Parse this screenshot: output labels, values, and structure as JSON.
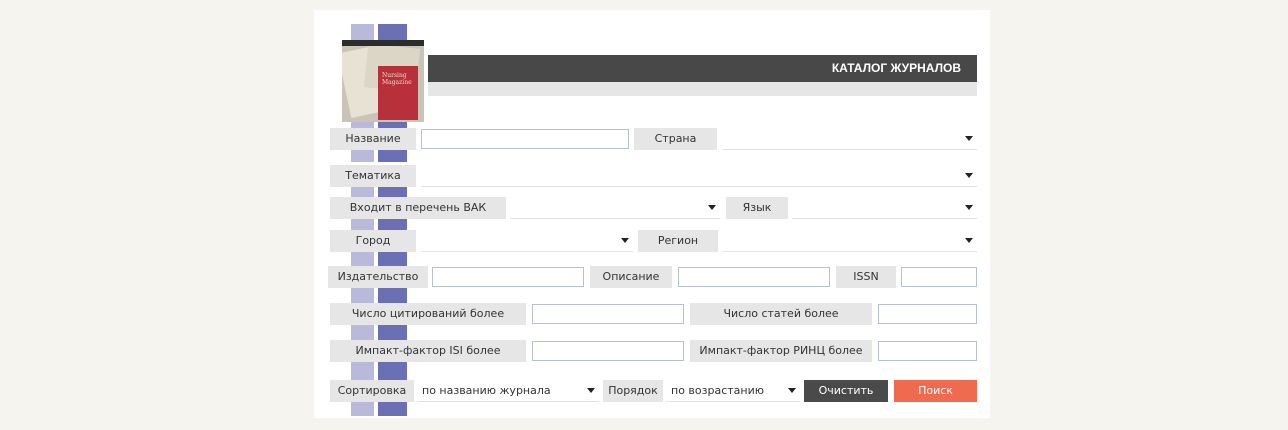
{
  "header": {
    "title": "КАТАЛОГ ЖУРНАЛОВ"
  },
  "cover": {
    "text": "Nursing Magazine"
  },
  "fields": {
    "name": {
      "label": "Название",
      "value": ""
    },
    "country": {
      "label": "Страна",
      "value": ""
    },
    "subject": {
      "label": "Тематика",
      "value": ""
    },
    "vak": {
      "label": "Входит в перечень ВАК",
      "value": ""
    },
    "language": {
      "label": "Язык",
      "value": ""
    },
    "city": {
      "label": "Город",
      "value": ""
    },
    "region": {
      "label": "Регион",
      "value": ""
    },
    "publisher": {
      "label": "Издательство",
      "value": ""
    },
    "description": {
      "label": "Описание",
      "value": ""
    },
    "issn": {
      "label": "ISSN",
      "value": ""
    },
    "citations": {
      "label": "Число цитирований более",
      "value": ""
    },
    "articles": {
      "label": "Число статей более",
      "value": ""
    },
    "isi": {
      "label": "Импакт-фактор ISI более",
      "value": ""
    },
    "rinc": {
      "label": "Импакт-фактор РИНЦ более",
      "value": ""
    },
    "sort": {
      "label": "Сортировка",
      "value": "по названию журнала"
    },
    "order": {
      "label": "Порядок",
      "value": "по возрастанию"
    }
  },
  "buttons": {
    "clear": "Очистить",
    "search": "Поиск"
  },
  "colors": {
    "header_bg": "#484848",
    "search_button": "#ef6a4f",
    "clear_button": "#4a4a4a",
    "stripe_light": "#b9b9dc",
    "stripe_dark": "#6b6fb4"
  }
}
